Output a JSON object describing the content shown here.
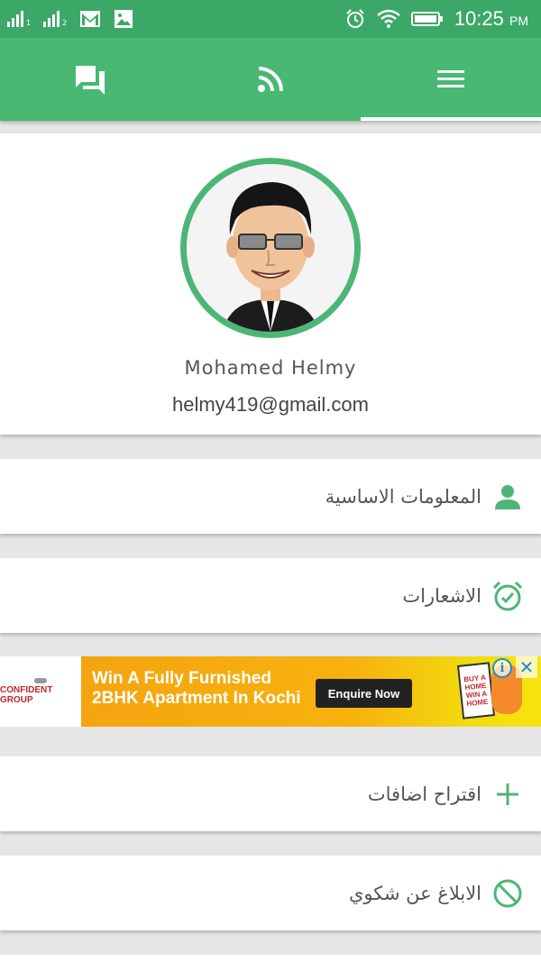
{
  "status_bar": {
    "sim1_label": "1",
    "sim2_label": "2",
    "icons": [
      "signal-icon",
      "signal-icon",
      "gmail-icon",
      "image-icon",
      "alarm-icon",
      "wifi-icon",
      "battery-icon"
    ],
    "time": "10:25",
    "ampm": "PM"
  },
  "top_nav": {
    "tabs": [
      {
        "icon": "chat-icon"
      },
      {
        "icon": "rss-icon"
      },
      {
        "icon": "menu-icon",
        "active": true
      }
    ]
  },
  "profile": {
    "name": "Mohamed Helmy",
    "email": "helmy419@gmail.com"
  },
  "menu": {
    "items": [
      {
        "label": "المعلومات الاساسية",
        "icon": "person-icon"
      },
      {
        "label": "الاشعارات",
        "icon": "alarm-check-icon"
      },
      {
        "label": "اقتراح اضافات",
        "icon": "plus-icon"
      },
      {
        "label": "الابلاغ عن شكوي",
        "icon": "block-icon"
      }
    ]
  },
  "ad": {
    "brand": "CONFIDENT GROUP",
    "headline_line1": "Win A Fully Furnished",
    "headline_line2": "2BHK Apartment In Kochi",
    "cta": "Enquire Now",
    "badge_lines": [
      "BUY A",
      "HOME",
      "WIN A",
      "HOME"
    ],
    "info_glyph": "i",
    "close_glyph": "✕"
  },
  "colors": {
    "status_bar": "#3ca868",
    "app_bar": "#48b872",
    "accent": "#4cb676",
    "background": "#e6e6e6"
  }
}
